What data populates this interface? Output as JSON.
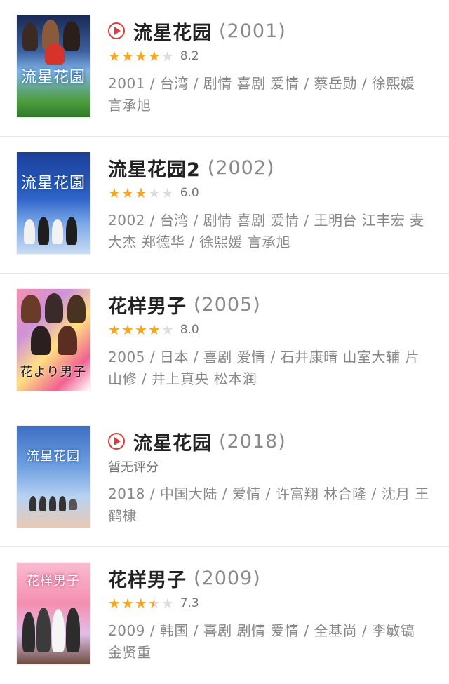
{
  "movies": [
    {
      "has_play": true,
      "title": "流星花园",
      "year": "(2001)",
      "stars": [
        "full",
        "full",
        "full",
        "full",
        "empty"
      ],
      "score": "8.2",
      "meta": "2001 / 台湾 / 剧情 喜剧 爱情 / 蔡岳勋 / 徐熙媛 言承旭",
      "poster_text": "流星花園",
      "poster_bg": "linear-gradient(180deg,#1a2a55 0%,#3c5f9e 35%,#7fb3e6 55%,#4c9c3c 85%,#2f7a2a 100%)"
    },
    {
      "has_play": false,
      "title": "流星花园2",
      "year": "(2002)",
      "stars": [
        "full",
        "full",
        "full",
        "empty",
        "empty"
      ],
      "score": "6.0",
      "meta": "2002 / 台湾 / 剧情 喜剧 爱情 / 王明台 江丰宏 麦大杰 郑德华 / 徐熙媛 言承旭",
      "poster_text": "流星花園",
      "poster_bg": "linear-gradient(180deg,#1b3f9a 0%,#2f63c8 45%,#7aa8e8 70%,#c9dcf2 100%)"
    },
    {
      "has_play": false,
      "title": "花样男子",
      "year": "(2005)",
      "stars": [
        "full",
        "full",
        "full",
        "full",
        "empty"
      ],
      "score": "8.0",
      "meta": "2005 / 日本 / 喜剧 爱情 / 石井康晴 山室大辅 片山修 / 井上真央 松本润",
      "poster_text": "花より男子",
      "poster_bg": "linear-gradient(135deg,#f48fb1 0%,#ce93d8 30%,#ffe082 55%,#f06292 80%,#ffffff 100%)"
    },
    {
      "has_play": true,
      "title": "流星花园",
      "year": "(2018)",
      "stars": [],
      "score": "",
      "no_rating": "暂无评分",
      "meta": "2018 / 中国大陆 / 爱情 / 许富翔 林合隆 / 沈月 王鹤棣",
      "poster_text": "流星花园",
      "poster_bg": "linear-gradient(180deg,#3e6fc4 0%,#6f9fe0 40%,#b8d2f2 70%,#e9c9b3 100%)"
    },
    {
      "has_play": false,
      "title": "花样男子",
      "year": "(2009)",
      "stars": [
        "full",
        "full",
        "full",
        "half",
        "empty"
      ],
      "score": "7.3",
      "meta": "2009 / 韩国 / 喜剧 剧情 爱情 / 全基尚 / 李敏镐 金贤重",
      "poster_text": "花样男子",
      "poster_bg": "linear-gradient(180deg,#f8bbd0 0%,#f48fb1 40%,#e1bee7 70%,#6d4c41 100%)"
    }
  ],
  "colors": {
    "accent_play": "#e23a3a",
    "star_full": "#f5a623",
    "star_empty": "#dddddd"
  }
}
